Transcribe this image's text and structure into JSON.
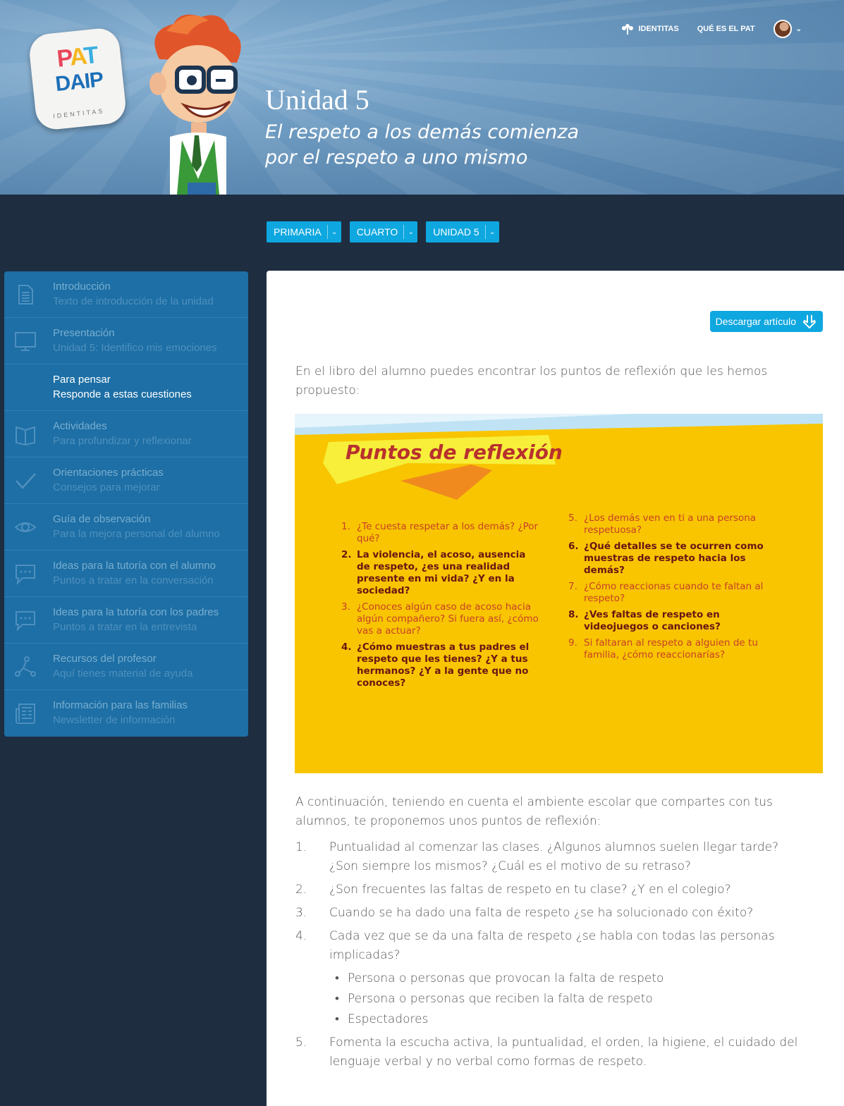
{
  "header": {
    "logo": {
      "pat": "PAT",
      "daip": "DAIP",
      "identitas": "IDENTITAS"
    },
    "title": "Unidad 5",
    "subtitle_line1": "El respeto a los demás comienza",
    "subtitle_line2": "por el respeto a uno mismo",
    "nav": {
      "identitas": "IDENTITAS",
      "que_es": "QUÉ ES EL PAT"
    }
  },
  "filters": [
    {
      "label": "PRIMARIA"
    },
    {
      "label": "CUARTO"
    },
    {
      "label": "UNIDAD 5"
    }
  ],
  "sidebar": {
    "items": [
      {
        "title": "Introducción",
        "subtitle": "Texto de introducción de la unidad",
        "icon": "document-icon"
      },
      {
        "title": "Presentación",
        "subtitle": "Unidad 5: Identifico mis emociones",
        "icon": "monitor-icon"
      },
      {
        "title": "Para pensar",
        "subtitle": "Responde a estas cuestiones",
        "icon": "none",
        "active": true
      },
      {
        "title": "Actividades",
        "subtitle": "Para profundizar y reflexionar",
        "icon": "book-icon"
      },
      {
        "title": "Orientaciones prácticas",
        "subtitle": "Consejos para mejorar",
        "icon": "check-icon"
      },
      {
        "title": "Guía de observación",
        "subtitle": "Para la mejora personal del alumno",
        "icon": "eye-icon"
      },
      {
        "title": "Ideas para la tutoría con el alumno",
        "subtitle": "Puntos a tratar en la conversación",
        "icon": "chat-icon"
      },
      {
        "title": "Ideas para la tutoría con los padres",
        "subtitle": "Puntos a tratar en la entrevista",
        "icon": "chat-icon"
      },
      {
        "title": "Recursos del profesor",
        "subtitle": "Aquí tienes material de ayuda",
        "icon": "network-icon"
      },
      {
        "title": "Información para las familias",
        "subtitle": "Newsletter de información",
        "icon": "newspaper-icon"
      }
    ]
  },
  "content": {
    "download_label": "Descargar artículo",
    "intro": "En el libro del alumno puedes encontrar los puntos de reflexión que les hemos propuesto:",
    "reflection": {
      "title": "Puntos de reflexión",
      "left": [
        {
          "n": "1.",
          "text": "¿Te cuesta respetar a los demás? ¿Por qué?",
          "style": "light"
        },
        {
          "n": "2.",
          "text": "La violencia, el acoso, ausencia de respeto, ¿es una realidad presente en mi vida? ¿Y en la sociedad?",
          "style": "dark"
        },
        {
          "n": "3.",
          "text": "¿Conoces algún caso de acoso hacia algún compañero? Si fuera así, ¿cómo vas a actuar?",
          "style": "light"
        },
        {
          "n": "4.",
          "text": "¿Cómo muestras a tus padres el respeto que les tienes? ¿Y a tus hermanos? ¿Y a la gente que no conoces?",
          "style": "dark"
        }
      ],
      "right": [
        {
          "n": "5.",
          "text": "¿Los demás ven en ti a una persona respetuosa?",
          "style": "light"
        },
        {
          "n": "6.",
          "text": "¿Qué detalles se te ocurren como muestras de respeto hacia los demás?",
          "style": "dark"
        },
        {
          "n": "7.",
          "text": "¿Cómo reaccionas cuando te faltan al respeto?",
          "style": "light"
        },
        {
          "n": "8.",
          "text": "¿Ves faltas de respeto en videojuegos o canciones?",
          "style": "dark"
        },
        {
          "n": "9.",
          "text": "Si faltaran al respeto a alguien de tu familia, ¿cómo reaccionarías?",
          "style": "light"
        }
      ]
    },
    "continuation": "A continuación, teniendo en cuenta el ambiente escolar que compartes con tus alumnos, te proponemos unos puntos de reflexión:",
    "list": [
      {
        "n": "1.",
        "text": "Puntualidad al comenzar las clases. ¿Algunos alumnos suelen llegar tarde? ¿Son siempre los mismos? ¿Cuál es el motivo de su retraso?"
      },
      {
        "n": "2.",
        "text": "¿Son frecuentes las faltas de respeto en tu clase? ¿Y en el colegio?"
      },
      {
        "n": "3.",
        "text": "Cuando se ha dado una falta de respeto ¿se ha solucionado con éxito?"
      },
      {
        "n": "4.",
        "text": "Cada vez que se da una falta de respeto ¿se habla con todas las personas implicadas?"
      },
      {
        "n": "5.",
        "text": "Fomenta la escucha activa, la puntualidad, el orden, la higiene, el cuidado del lenguaje verbal y no verbal como formas de respeto."
      }
    ],
    "sublist": [
      "Persona o personas que provocan la falta de respeto",
      "Persona o personas que reciben la falta de respeto",
      "Espectadores"
    ]
  }
}
